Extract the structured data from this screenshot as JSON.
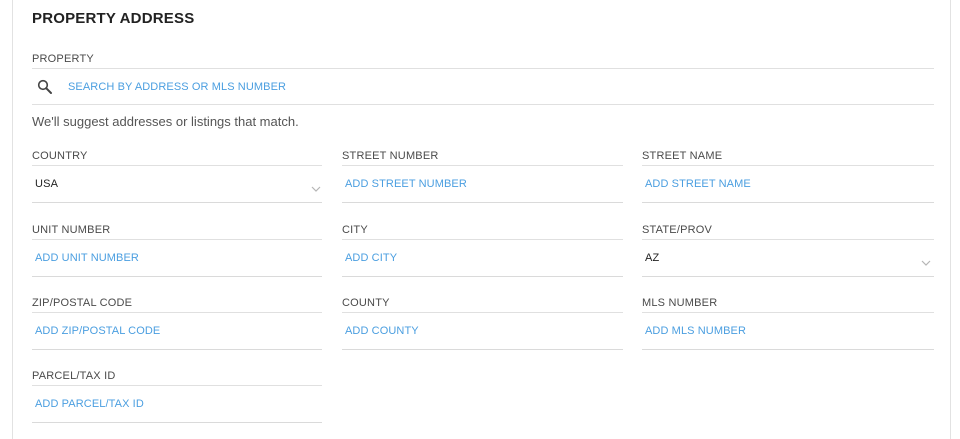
{
  "section": {
    "title": "PROPERTY ADDRESS"
  },
  "property": {
    "label": "PROPERTY",
    "search_placeholder": "SEARCH BY ADDRESS OR MLS NUMBER",
    "hint": "We'll suggest addresses or listings that match."
  },
  "fields": {
    "country": {
      "label": "COUNTRY",
      "value": "USA"
    },
    "street_number": {
      "label": "STREET NUMBER",
      "placeholder": "ADD STREET NUMBER"
    },
    "street_name": {
      "label": "STREET NAME",
      "placeholder": "ADD STREET NAME"
    },
    "unit_number": {
      "label": "UNIT NUMBER",
      "placeholder": "ADD UNIT NUMBER"
    },
    "city": {
      "label": "CITY",
      "placeholder": "ADD CITY"
    },
    "state_prov": {
      "label": "STATE/PROV",
      "value": "AZ"
    },
    "zip": {
      "label": "ZIP/POSTAL CODE",
      "placeholder": "ADD ZIP/POSTAL CODE"
    },
    "county": {
      "label": "COUNTY",
      "placeholder": "ADD COUNTY"
    },
    "mls_number": {
      "label": "MLS NUMBER",
      "placeholder": "ADD MLS NUMBER"
    },
    "parcel": {
      "label": "PARCEL/TAX ID",
      "placeholder": "ADD PARCEL/TAX ID"
    }
  },
  "icons": {
    "search": "search-icon",
    "dropdown": "chevron-down-icon"
  },
  "colors": {
    "placeholder": "#4a9ee0",
    "divider": "#e0e0e0"
  }
}
